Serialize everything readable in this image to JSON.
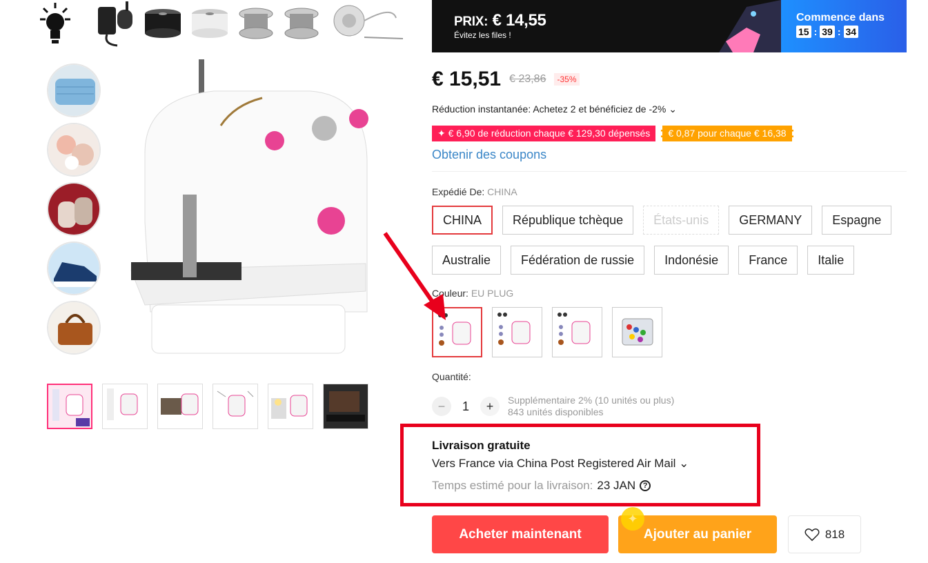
{
  "flash": {
    "price_label": "PRIX:",
    "price": "€ 14,55",
    "subtitle": "Évitez les files !",
    "countdown_title": "Commence dans",
    "timer": [
      "15",
      "39",
      "34"
    ],
    "colors": {
      "left_bg": "#111111",
      "right_bg": "#1e90ff"
    }
  },
  "price": {
    "current": "€ 15,51",
    "original": "€ 23,86",
    "discount": "-35%"
  },
  "promo": {
    "reduction": "Réduction instantanée: Achetez 2 et bénéficiez de -2% ⌄",
    "tag_red": "✦ € 6,90 de réduction chaque € 129,30 dépensés",
    "tag_orange": "€ 0,87 pour chaque € 16,38",
    "coupons": "Obtenir des coupons"
  },
  "ship_from": {
    "label": "Expédié De:",
    "value": "CHINA",
    "options": [
      "CHINA",
      "République tchèque",
      "États-unis",
      "GERMANY",
      "Espagne",
      "Australie",
      "Fédération de russie",
      "Indonésie",
      "France",
      "Italie"
    ],
    "selected": "CHINA",
    "disabled": "États-unis"
  },
  "color": {
    "label": "Couleur:",
    "value": "EU PLUG",
    "swatches": [
      "sewing-machine-kit-1",
      "sewing-machine-kit-2",
      "sewing-machine-kit-3",
      "bobbin-box"
    ]
  },
  "quantity": {
    "label": "Quantité:",
    "minus": "−",
    "value": "1",
    "plus": "+",
    "extra": "Supplémentaire 2% (10 unités ou plus)",
    "stock": "843 unités disponibles"
  },
  "shipping": {
    "title": "Livraison gratuite",
    "via": "Vers France via China Post Registered Air Mail ⌄",
    "estimate_label": "Temps estimé pour la livraison:",
    "estimate_date": "23 JAN",
    "help": "?"
  },
  "actions": {
    "buy": "Acheter maintenant",
    "cart": "Ajouter au panier",
    "wishlist_count": "818",
    "colors": {
      "buy": "#ff4747",
      "cart": "#ffa31a"
    }
  },
  "gallery": {
    "vertical_thumbs": [
      "face-mask",
      "fabric-items",
      "knit-mittens",
      "sneaker",
      "leather-bag"
    ],
    "horizontal_thumbs": [
      "product-1",
      "product-2",
      "product-3",
      "product-4",
      "product-5",
      "product-6"
    ],
    "accessories": [
      "light-bulb",
      "power-adapter",
      "thread-spool-black",
      "thread-spool-white",
      "bobbin-1",
      "bobbin-2",
      "needle-threader"
    ]
  }
}
